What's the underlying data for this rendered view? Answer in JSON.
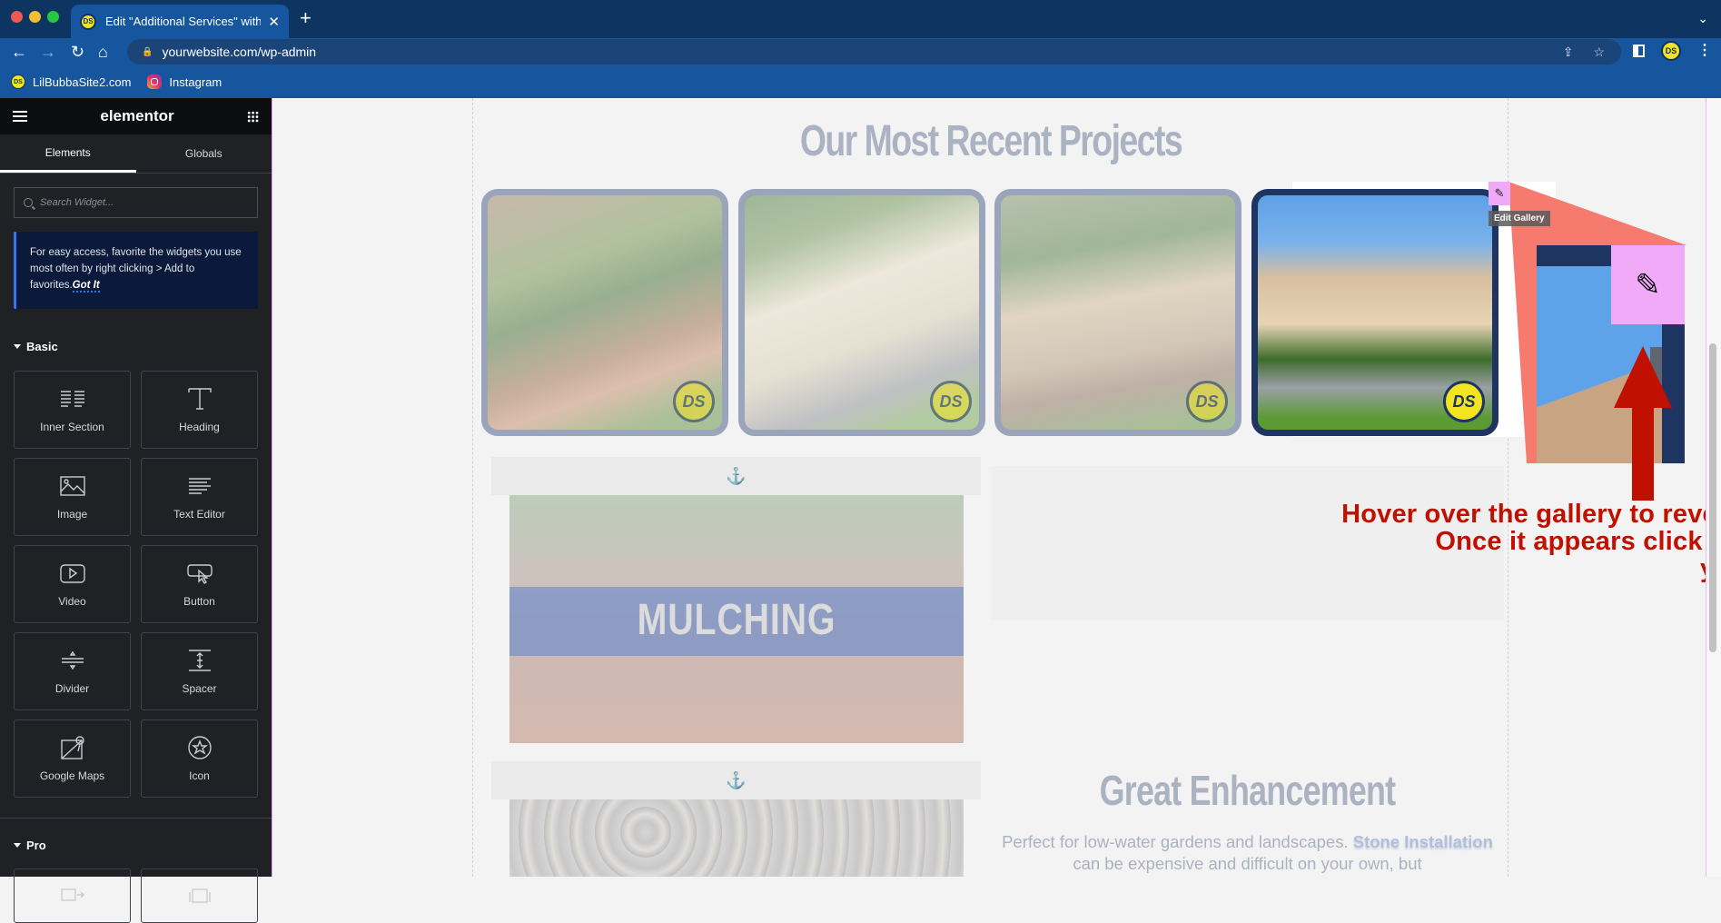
{
  "browser": {
    "tab_title": "Edit \"Additional Services\" with Elementor",
    "tab_favicon": "DS",
    "url": "yourwebsite.com/wp-admin",
    "bookmarks": [
      {
        "label": "LilBubbaSite2.com",
        "icon": "ds-logo-icon"
      },
      {
        "label": "Instagram",
        "icon": "instagram-icon"
      }
    ],
    "profile_initials": "DS"
  },
  "panel": {
    "logo": "elementor",
    "tabs": [
      {
        "label": "Elements",
        "active": true
      },
      {
        "label": "Globals",
        "active": false
      }
    ],
    "search_placeholder": "Search Widget...",
    "tip_text": "For easy access, favorite the widgets you use most often by right clicking > Add to favorites.",
    "tip_link": "Got It",
    "sections": [
      {
        "title": "Basic",
        "widgets": [
          {
            "label": "Inner Section",
            "icon": "inner-section-icon"
          },
          {
            "label": "Heading",
            "icon": "heading-icon"
          },
          {
            "label": "Image",
            "icon": "image-icon"
          },
          {
            "label": "Text Editor",
            "icon": "text-editor-icon"
          },
          {
            "label": "Video",
            "icon": "video-icon"
          },
          {
            "label": "Button",
            "icon": "button-icon"
          },
          {
            "label": "Divider",
            "icon": "divider-icon"
          },
          {
            "label": "Spacer",
            "icon": "spacer-icon"
          },
          {
            "label": "Google Maps",
            "icon": "google-maps-icon"
          },
          {
            "label": "Icon",
            "icon": "star-icon"
          }
        ]
      },
      {
        "title": "Pro"
      }
    ]
  },
  "canvas": {
    "recent_title": "Our Most Recent Projects",
    "gallery": {
      "items": [
        {
          "name": "mulch-bed-curb",
          "badge": "DS"
        },
        {
          "name": "white-stone-curb",
          "badge": "DS"
        },
        {
          "name": "gravel-path-curb",
          "badge": "DS"
        },
        {
          "name": "house-front-curb",
          "badge": "DS"
        }
      ],
      "edit_tooltip": "Edit Gallery"
    },
    "instruction": {
      "line1": "Hover over the gallery to reveal the pencil icon.",
      "line2": "Once it appears click the icon to access",
      "line3": "your image gallery.",
      "color": "#c01000"
    },
    "mulching_label": "MULCHING",
    "great_title": "Great Enhancement",
    "great_text_before": "Perfect for low-water gardens and landscapes. ",
    "great_text_link": "Stone Installation",
    "great_text_after": " can be expensive and difficult on your own, but"
  }
}
